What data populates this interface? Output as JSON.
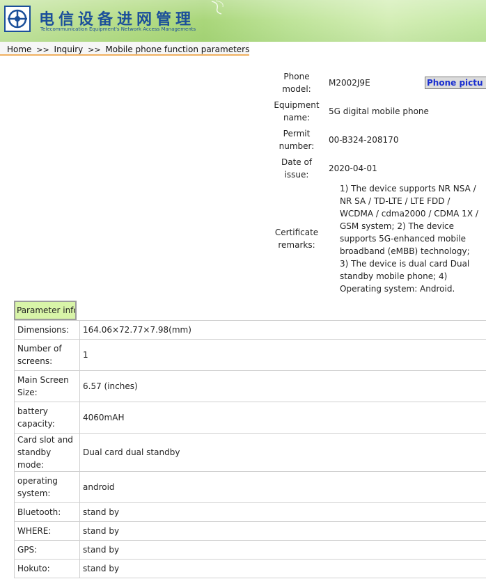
{
  "banner": {
    "title_cn": "电信设备进网管理",
    "title_en": "Telecommunication Equipment's Network Access Managements",
    "logo_icon": "telecom-logo-icon",
    "colors": {
      "brand_blue": "#1b4f9a",
      "banner_green": "#b4dc86"
    }
  },
  "breadcrumb": {
    "home": "Home",
    "sep": ">>",
    "inquiry": "Inquiry",
    "current": "Mobile phone function parameters",
    "underline_color": "#f0b060"
  },
  "info": {
    "model_label": "Phone model:",
    "model": "M2002J9E",
    "name_label": "Equipment name:",
    "name": "5G digital mobile phone",
    "permit_label": "Permit number:",
    "permit": "00-B324-208170",
    "date_label": "Date of issue:",
    "date": "2020-04-01",
    "remarks_label": "Certificate remarks:",
    "remarks": "1) The device supports NR NSA / NR SA / TD-LTE / LTE FDD / WCDMA / cdma2000 / CDMA 1X / GSM system; 2) The device supports 5G-enhanced mobile broadband (eMBB) technology; 3) The device is dual card Dual standby mobile phone; 4) Operating system: Android.",
    "picture_button": "Phone pictu"
  },
  "params": {
    "tab": "Parameter info",
    "rows": [
      {
        "k": "Dimensions:",
        "v": "164.06×72.77×7.98(mm)"
      },
      {
        "k": "Number of screens:",
        "v": "1"
      },
      {
        "k": "Main Screen Size:",
        "v": "6.57 (inches)"
      },
      {
        "k": "battery capacity:",
        "v": "4060mAH"
      },
      {
        "k": "Card slot and standby mode:",
        "v": "Dual card dual standby"
      },
      {
        "k": "operating system:",
        "v": "android"
      },
      {
        "k": "Bluetooth:",
        "v": "stand by"
      },
      {
        "k": "WHERE:",
        "v": "stand by"
      },
      {
        "k": "GPS:",
        "v": "stand by"
      },
      {
        "k": "Hokuto:",
        "v": "stand by"
      }
    ]
  }
}
